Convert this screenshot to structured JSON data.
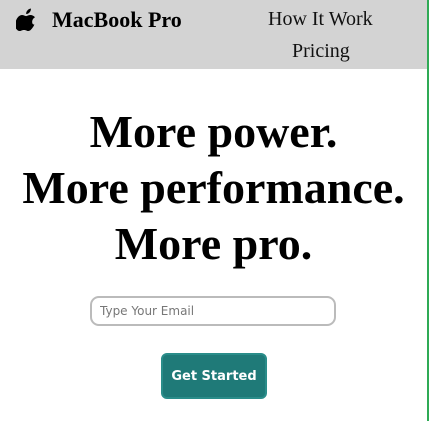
{
  "header": {
    "brand": "MacBook Pro",
    "logo_icon": "apple-icon",
    "nav": {
      "how_it_works": "How It Work",
      "pricing": "Pricing"
    }
  },
  "hero": {
    "lines": [
      "More power.",
      "More performance.",
      "More pro."
    ],
    "email_placeholder": "Type Your Email",
    "cta_label": "Get Started"
  },
  "colors": {
    "navbar_bg": "#d3d3d3",
    "cta_bg": "#1f7a78",
    "right_border": "#2faa55"
  }
}
